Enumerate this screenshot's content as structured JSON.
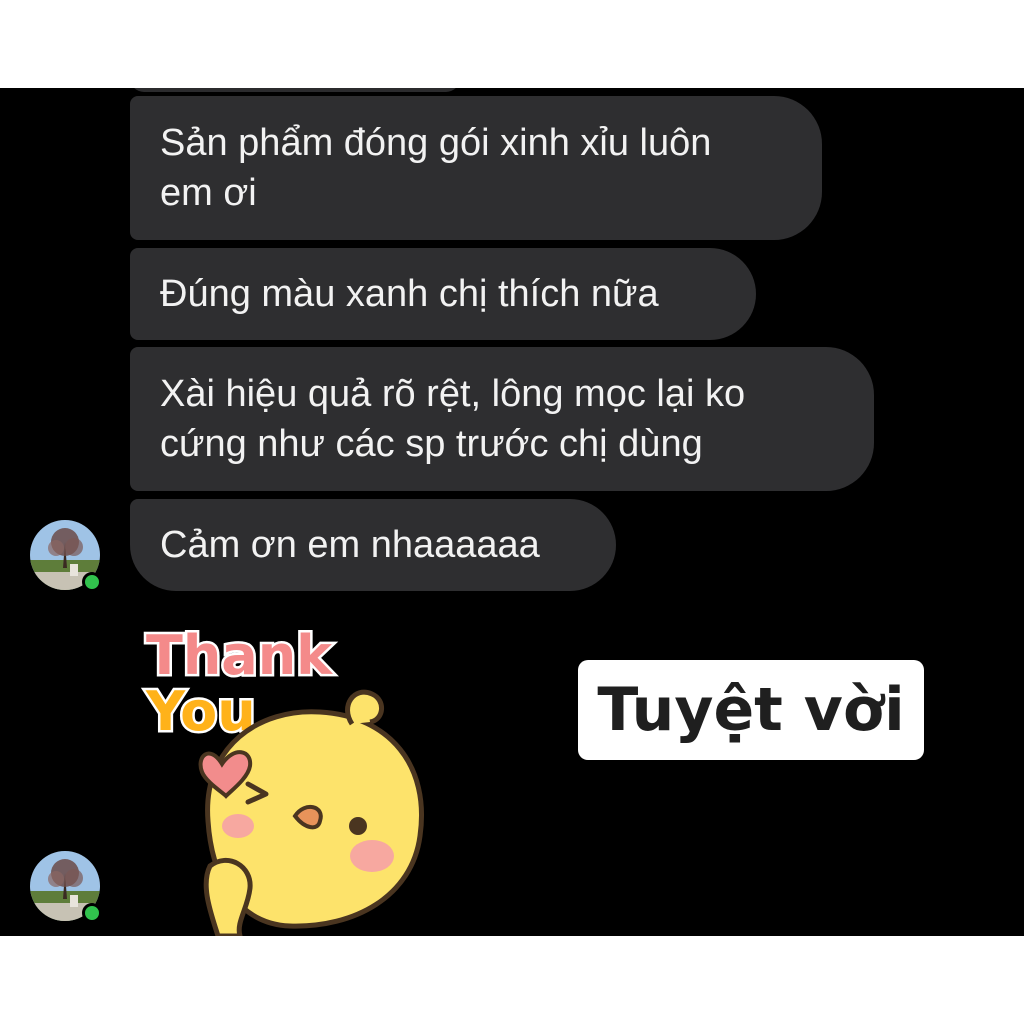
{
  "messages": [
    {
      "lines": [
        "Sản phẩm đóng gói xinh xỉu luôn",
        "em ơi"
      ]
    },
    {
      "lines": [
        "Đúng màu xanh chị thích nữa"
      ]
    },
    {
      "lines": [
        "Xài hiệu quả rõ rệt, lông mọc lại ko",
        "cứng như các sp trước chị dùng"
      ]
    },
    {
      "lines": [
        "Cảm ơn em nhaaaaaa"
      ]
    }
  ],
  "sticker": {
    "line1": "Thank",
    "line2": "You"
  },
  "overlay_caption": "Tuyệt vời",
  "colors": {
    "chat_background": "#000000",
    "bubble": "#2e2e30",
    "bubble_text": "#f2f2f2",
    "online_indicator": "#31c24d",
    "sticker_thank": "#f48a8a",
    "sticker_you": "#ffb21a",
    "sticker_chick": "#fde36b"
  },
  "icons": [
    "contact-avatar",
    "online-status-dot",
    "thank-you-chick-sticker",
    "heart-icon"
  ]
}
